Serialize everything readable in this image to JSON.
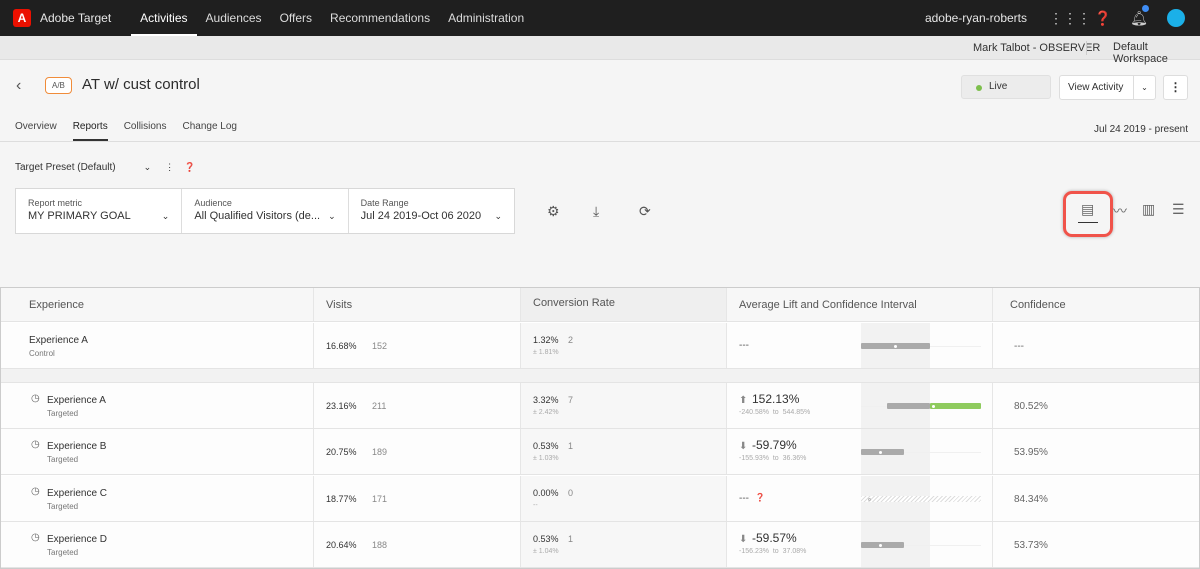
{
  "topbar": {
    "logo": "A",
    "brand": "Adobe Target",
    "nav": [
      "Activities",
      "Audiences",
      "Offers",
      "Recommendations",
      "Administration"
    ],
    "active": "Activities",
    "user": "adobe-ryan-roberts"
  },
  "subbar": {
    "observer": "Mark Talbot - OBSERVER",
    "workspace": "Default Workspace"
  },
  "activity": {
    "type": "A/B",
    "title": "AT w/ cust control",
    "status": "Live",
    "view_button": "View Activity",
    "date_range": "Jul 24 2019 - present"
  },
  "tabs": [
    "Overview",
    "Reports",
    "Collisions",
    "Change Log"
  ],
  "active_tab": "Reports",
  "preset": "Target Preset (Default)",
  "filters": [
    {
      "label": "Report metric",
      "value": "MY PRIMARY GOAL"
    },
    {
      "label": "Audience",
      "value": "All Qualified Visitors (de..."
    },
    {
      "label": "Date Range",
      "value": "Jul 24 2019-Oct 06 2020"
    }
  ],
  "table": {
    "headers": [
      "Experience",
      "Visits",
      "Conversion Rate",
      "Average Lift and Confidence Interval",
      "Confidence"
    ],
    "control": {
      "name": "Experience A",
      "kind": "Control",
      "visits_pct": "16.68%",
      "visits": "152",
      "conv": "1.32%",
      "conv_n": "2",
      "conv_ci": "± 1.81%",
      "lift": "---",
      "confidence": "---"
    },
    "rows": [
      {
        "name": "Experience A",
        "kind": "Targeted",
        "visits_pct": "23.16%",
        "visits": "211",
        "conv": "3.32%",
        "conv_n": "7",
        "conv_ci": "± 2.42%",
        "lift": "152.13%",
        "dir": "up",
        "lo": "-240.58%",
        "hi": "544.85%",
        "confidence": "80.52%",
        "lift_v": 152.13,
        "lo_v": -32,
        "hi_v": 544.85
      },
      {
        "name": "Experience B",
        "kind": "Targeted",
        "visits_pct": "20.75%",
        "visits": "189",
        "conv": "0.53%",
        "conv_n": "1",
        "conv_ci": "± 1.03%",
        "lift": "-59.79%",
        "dir": "down",
        "lo": "-155.93%",
        "hi": "36.36%",
        "confidence": "53.95%",
        "lift_v": -59.79,
        "lo_v": -155.93,
        "hi_v": 36.36
      },
      {
        "name": "Experience C",
        "kind": "Targeted",
        "visits_pct": "18.77%",
        "visits": "171",
        "conv": "0.00%",
        "conv_n": "0",
        "conv_ci": "--",
        "lift": "---",
        "dir": "none",
        "lo": "",
        "hi": "",
        "confidence": "84.34%"
      },
      {
        "name": "Experience D",
        "kind": "Targeted",
        "visits_pct": "20.64%",
        "visits": "188",
        "conv": "0.53%",
        "conv_n": "1",
        "conv_ci": "± 1.04%",
        "lift": "-59.57%",
        "dir": "down",
        "lo": "-156.23%",
        "hi": "37.08%",
        "confidence": "53.73%",
        "lift_v": -59.57,
        "lo_v": -156.23,
        "hi_v": 37.08
      }
    ],
    "to": "to"
  },
  "colors": {
    "positive": "#8fcb5e",
    "neutral": "#aaaaaa",
    "highlight": "#f0534a"
  }
}
